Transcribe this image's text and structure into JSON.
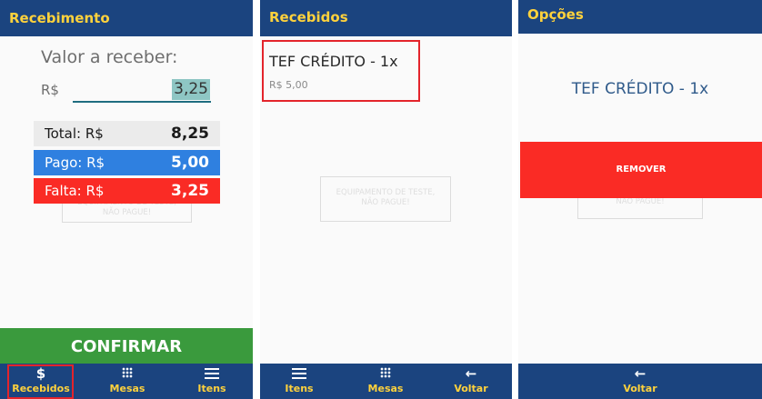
{
  "screen1": {
    "title": "Recebimento",
    "valor_label": "Valor a receber:",
    "currency": "R$",
    "input_value": "3,25",
    "total_label": "Total: R$",
    "total_value": "8,25",
    "pago_label": "Pago: R$",
    "pago_value": "5,00",
    "falta_label": "Falta: R$",
    "falta_value": "3,25",
    "watermark": "EQUIPAMENTO DE TESTE, NÃO PAGUE!",
    "confirm_label": "CONFIRMAR",
    "nav": [
      {
        "label": "Recebidos",
        "icon": "dollar-icon"
      },
      {
        "label": "Mesas",
        "icon": "grid-icon"
      },
      {
        "label": "Itens",
        "icon": "menu-icon"
      }
    ]
  },
  "screen2": {
    "title": "Recebidos",
    "item_title": "TEF CRÉDITO - 1x",
    "item_value": "R$ 5,00",
    "watermark": "EQUIPAMENTO DE TESTE, NÃO PAGUE!",
    "nav": [
      {
        "label": "Itens",
        "icon": "menu-icon"
      },
      {
        "label": "Mesas",
        "icon": "grid-icon"
      },
      {
        "label": "Voltar",
        "icon": "arrow-left-icon"
      }
    ]
  },
  "screen3": {
    "title": "Opções",
    "option_title": "TEF CRÉDITO - 1x",
    "remove_label": "REMOVER",
    "watermark": "EQUIPAMENTO DE TESTE, NÃO PAGUE!",
    "nav": [
      {
        "label": "Voltar",
        "icon": "arrow-left-icon"
      }
    ]
  },
  "colors": {
    "appbar": "#1b447f",
    "appbar_text": "#ffd23c",
    "confirm": "#3a9a3d",
    "pago": "#2f80e0",
    "falta": "#fa2b25",
    "highlight": "#e3242b"
  }
}
